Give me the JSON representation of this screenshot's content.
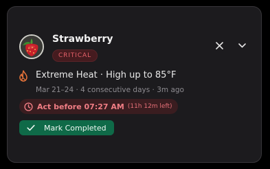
{
  "notification": {
    "title": "Strawberry",
    "severity": "CRITICAL",
    "headline": "Extreme Heat · High up to 85°F",
    "details": "Mar 21–24 · 4 consecutive days · 3m ago",
    "deadline_label": "Act before 07:27 AM",
    "deadline_remaining": "(11h 12m left)",
    "action_label": "Mark Completed"
  },
  "icons": {
    "avatar": "strawberry-thumbnail",
    "close": "close-icon",
    "expand": "chevron-down-icon",
    "alert": "flame-icon",
    "deadline": "clock-icon",
    "action": "check-icon"
  },
  "colors": {
    "card_background": "#1c1b1e",
    "critical_text": "#e6616a",
    "critical_background": "#451b1f",
    "flame": "#e8743a",
    "action_background": "#0f6a48"
  }
}
